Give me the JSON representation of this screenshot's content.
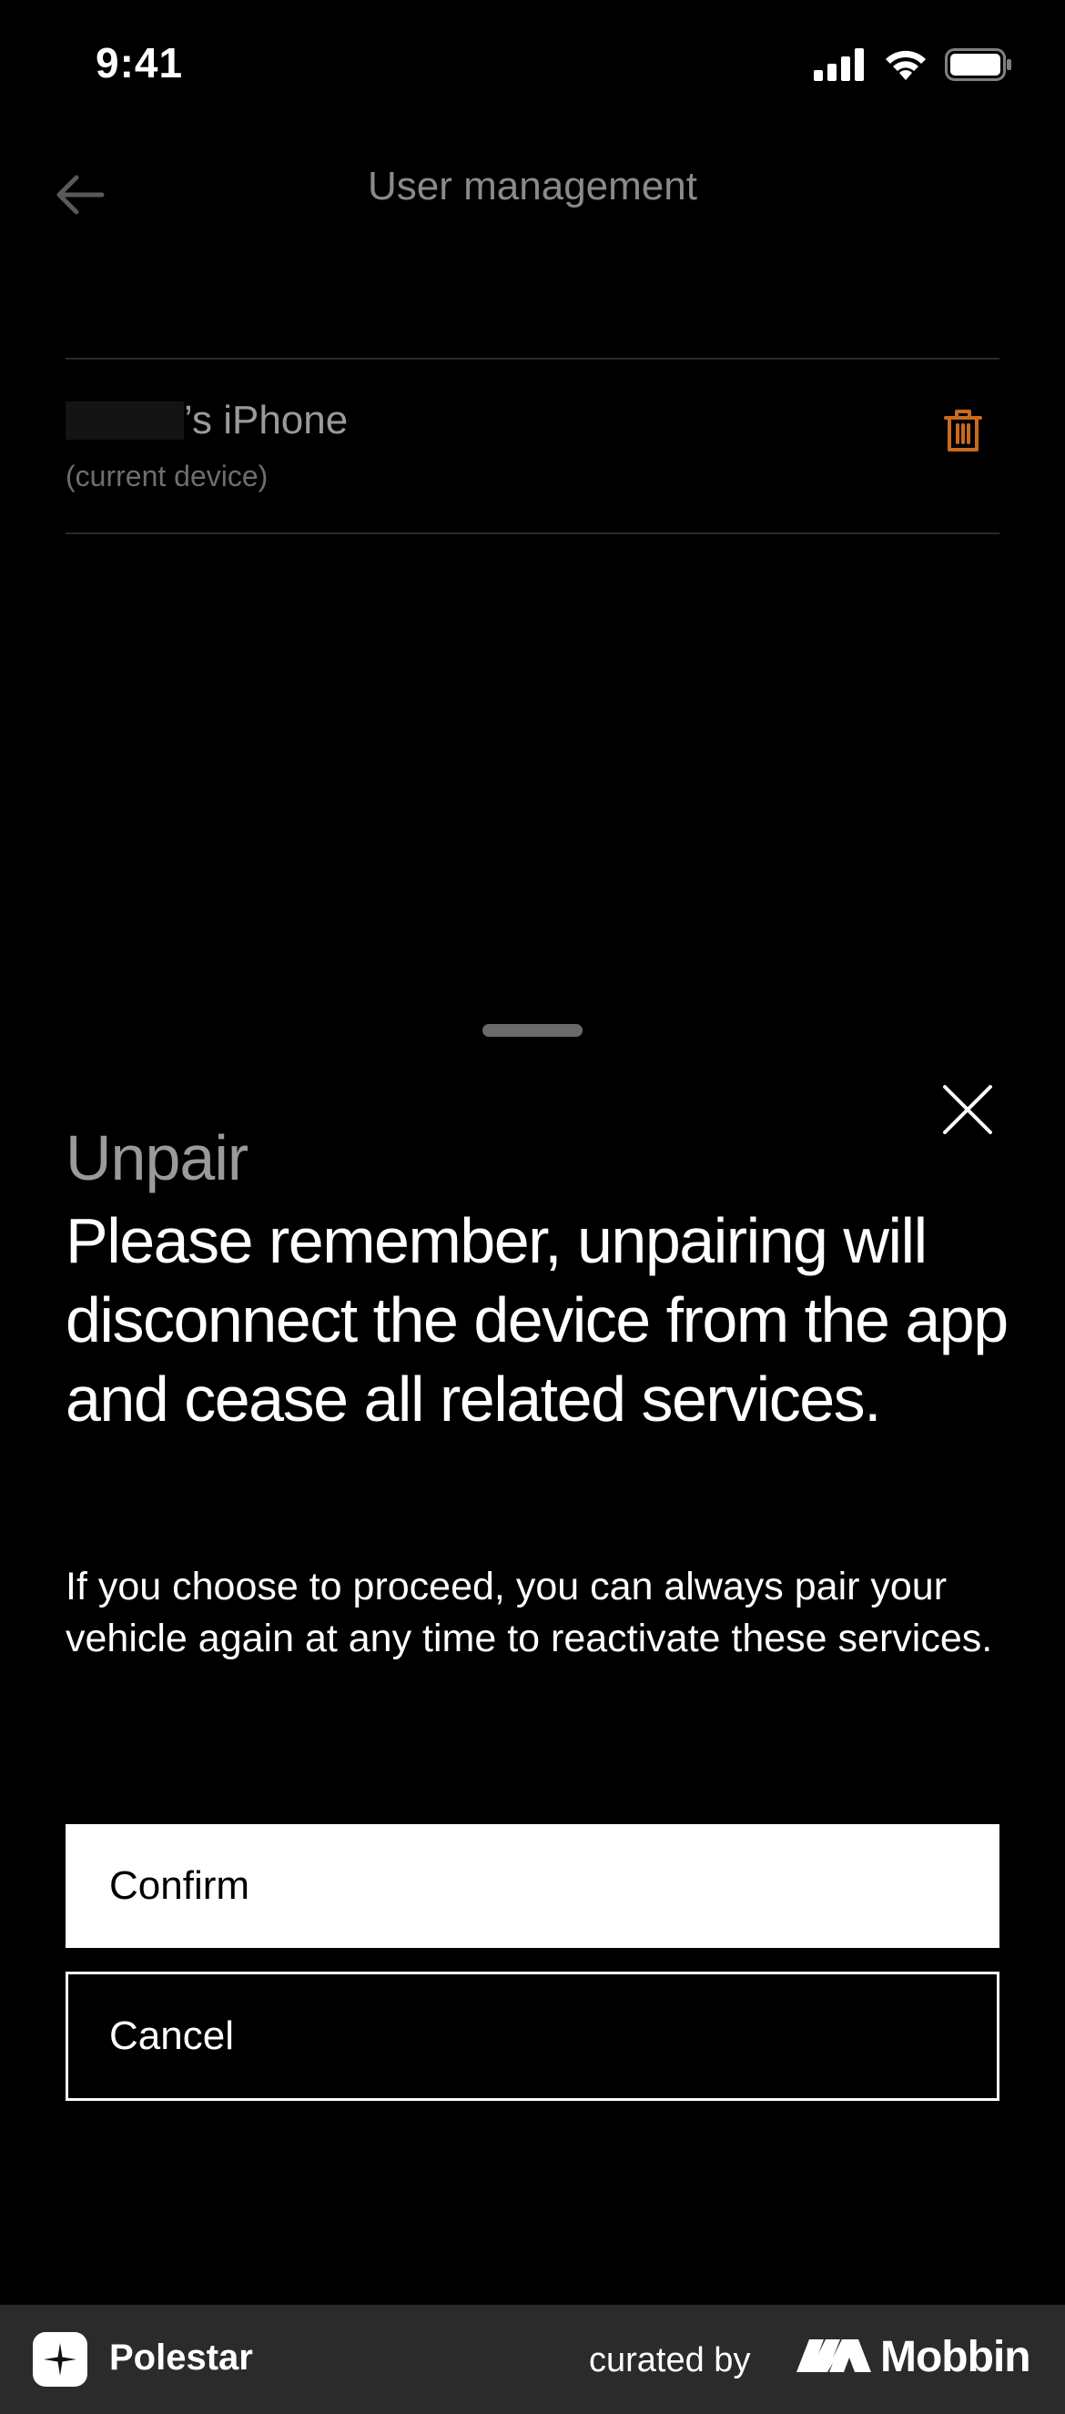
{
  "status_bar": {
    "time": "9:41",
    "icons": [
      "cellular-signal-icon",
      "wifi-icon",
      "battery-icon"
    ]
  },
  "header": {
    "title": "User management",
    "back_icon": "arrow-left-icon"
  },
  "device": {
    "name": "’s iPhone",
    "subtitle": "(current device)",
    "delete_icon": "trash-icon",
    "accent_color": "#c86a1e"
  },
  "sheet": {
    "overline": "Unpair",
    "heading": "Please remember, unpairing will disconnect the device from the app and cease all related services.",
    "body": "If you choose to proceed, you can always pair your vehicle again at any time to reactivate these services.",
    "confirm_label": "Confirm",
    "cancel_label": "Cancel",
    "close_icon": "close-icon"
  },
  "footer": {
    "app_name": "Polestar",
    "curated_by": "curated by",
    "brand": "Mobbin"
  }
}
